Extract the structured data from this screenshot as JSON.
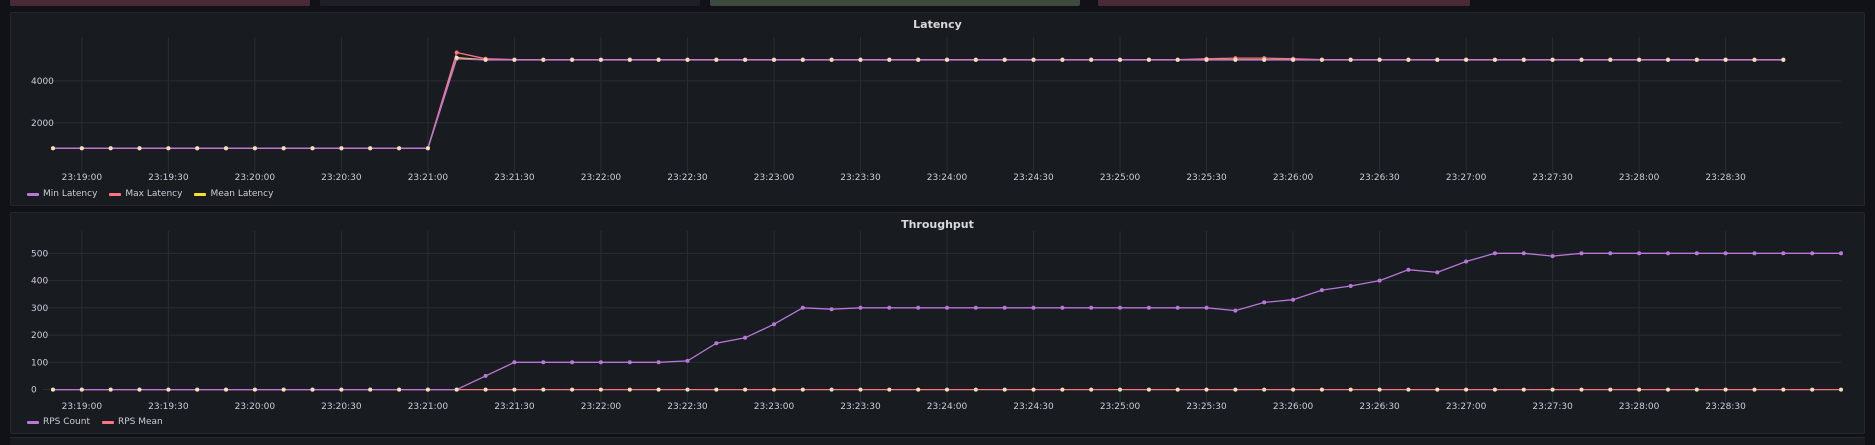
{
  "colors": {
    "min_latency": "#b877d9",
    "max_latency": "#ff7383",
    "mean_latency": "#fade2a",
    "rps_count": "#b877d9",
    "rps_mean": "#ff7383",
    "marker": "#f2e2b8",
    "grid": "#2a2d33",
    "tick_text": "#ccccdc"
  },
  "top_blocks": [
    {
      "color": "#4a2a35"
    },
    {
      "color": "#1d2026"
    },
    {
      "color": "#3d4a3d"
    },
    {
      "color": "#4a2a35"
    }
  ],
  "chart_data": [
    {
      "type": "line",
      "title": "Latency",
      "x_tick_labels": [
        "23:19:00",
        "23:19:30",
        "23:20:00",
        "23:20:30",
        "23:21:00",
        "23:21:30",
        "23:22:00",
        "23:22:30",
        "23:23:00",
        "23:23:30",
        "23:24:00",
        "23:24:30",
        "23:25:00",
        "23:25:30",
        "23:26:00",
        "23:26:30",
        "23:27:00",
        "23:27:30",
        "23:28:00",
        "23:28:30"
      ],
      "y_ticks": [
        2000,
        4000
      ],
      "ylim": [
        0,
        5800
      ],
      "x_start": "23:18:50",
      "sample_interval_s": 10,
      "legend_placement": "bottom-left",
      "grid": true,
      "series": [
        {
          "name": "Min Latency",
          "values": [
            800,
            800,
            800,
            800,
            800,
            800,
            800,
            800,
            800,
            800,
            800,
            800,
            800,
            800,
            5050,
            4990,
            4990,
            4990,
            4990,
            4990,
            4990,
            4990,
            4990,
            4990,
            4990,
            4990,
            4990,
            4990,
            4990,
            4990,
            4990,
            4990,
            4990,
            4990,
            4990,
            4990,
            4990,
            4990,
            4990,
            4990,
            4990,
            4990,
            4990,
            4990,
            4990,
            4990,
            4990,
            4990,
            4990,
            4990,
            4990,
            4990,
            4990,
            4990,
            4990,
            4990,
            4990,
            4990,
            4990,
            4990,
            4990
          ]
        },
        {
          "name": "Max Latency",
          "values": [
            800,
            800,
            800,
            800,
            800,
            800,
            800,
            800,
            800,
            800,
            800,
            800,
            800,
            800,
            5350,
            5050,
            5010,
            5010,
            5010,
            5010,
            5010,
            5010,
            5010,
            5010,
            5010,
            5010,
            5010,
            5010,
            5010,
            5010,
            5010,
            5010,
            5010,
            5010,
            5010,
            5010,
            5010,
            5010,
            5010,
            5010,
            5050,
            5080,
            5080,
            5050,
            5010,
            5010,
            5010,
            5010,
            5010,
            5010,
            5010,
            5010,
            5010,
            5010,
            5010,
            5010,
            5010,
            5010,
            5010,
            5010,
            5010
          ]
        },
        {
          "name": "Mean Latency",
          "values": [
            800,
            800,
            800,
            800,
            800,
            800,
            800,
            800,
            800,
            800,
            800,
            800,
            800,
            800,
            5100,
            5000,
            5000,
            5000,
            5000,
            5000,
            5000,
            5000,
            5000,
            5000,
            5000,
            5000,
            5000,
            5000,
            5000,
            5000,
            5000,
            5000,
            5000,
            5000,
            5000,
            5000,
            5000,
            5000,
            5000,
            5000,
            5000,
            5000,
            5000,
            5000,
            5000,
            5000,
            5000,
            5000,
            5000,
            5000,
            5000,
            5000,
            5000,
            5000,
            5000,
            5000,
            5000,
            5000,
            5000,
            5000,
            5000
          ]
        }
      ]
    },
    {
      "type": "line",
      "title": "Throughput",
      "x_tick_labels": [
        "23:19:00",
        "23:19:30",
        "23:20:00",
        "23:20:30",
        "23:21:00",
        "23:21:30",
        "23:22:00",
        "23:22:30",
        "23:23:00",
        "23:23:30",
        "23:24:00",
        "23:24:30",
        "23:25:00",
        "23:25:30",
        "23:26:00",
        "23:26:30",
        "23:27:00",
        "23:27:30",
        "23:28:00",
        "23:28:30"
      ],
      "y_ticks": [
        0,
        100,
        200,
        300,
        400,
        500
      ],
      "ylim": [
        -20,
        560
      ],
      "x_start": "23:18:50",
      "sample_interval_s": 10,
      "legend_placement": "bottom-left",
      "grid": true,
      "series": [
        {
          "name": "RPS Count",
          "values": [
            0,
            0,
            0,
            0,
            0,
            0,
            0,
            0,
            0,
            0,
            0,
            0,
            0,
            0,
            0,
            50,
            100,
            100,
            100,
            100,
            100,
            100,
            105,
            170,
            190,
            240,
            300,
            295,
            300,
            300,
            300,
            300,
            300,
            300,
            300,
            300,
            300,
            300,
            300,
            300,
            300,
            290,
            320,
            330,
            365,
            380,
            400,
            440,
            430,
            470,
            500,
            500,
            490,
            500,
            500,
            500,
            500,
            500,
            500,
            500,
            500,
            500,
            500
          ]
        },
        {
          "name": "RPS Mean",
          "values": [
            0,
            0,
            0,
            0,
            0,
            0,
            0,
            0,
            0,
            0,
            0,
            0,
            0,
            0,
            0,
            0,
            0,
            0,
            0,
            0,
            0,
            0,
            0,
            0,
            0,
            0,
            0,
            0,
            0,
            0,
            0,
            0,
            0,
            0,
            0,
            0,
            0,
            0,
            0,
            0,
            0,
            0,
            0,
            0,
            0,
            0,
            0,
            0,
            0,
            0,
            0,
            0,
            0,
            0,
            0,
            0,
            0,
            0,
            0,
            0,
            0,
            0,
            0
          ]
        }
      ]
    }
  ]
}
